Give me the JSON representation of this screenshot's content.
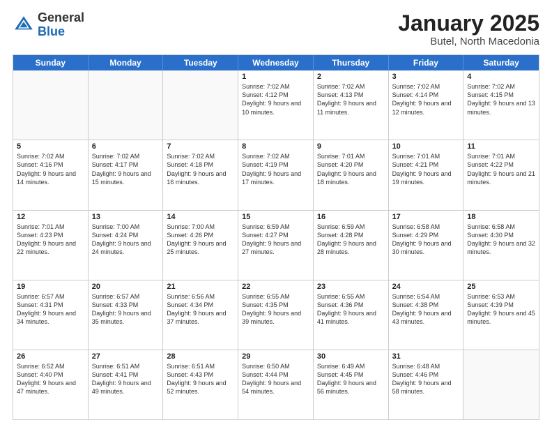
{
  "logo": {
    "general": "General",
    "blue": "Blue"
  },
  "title": "January 2025",
  "location": "Butel, North Macedonia",
  "days": [
    "Sunday",
    "Monday",
    "Tuesday",
    "Wednesday",
    "Thursday",
    "Friday",
    "Saturday"
  ],
  "rows": [
    [
      {
        "day": "",
        "sunrise": "",
        "sunset": "",
        "daylight": "",
        "empty": true
      },
      {
        "day": "",
        "sunrise": "",
        "sunset": "",
        "daylight": "",
        "empty": true
      },
      {
        "day": "",
        "sunrise": "",
        "sunset": "",
        "daylight": "",
        "empty": true
      },
      {
        "day": "1",
        "sunrise": "Sunrise: 7:02 AM",
        "sunset": "Sunset: 4:12 PM",
        "daylight": "Daylight: 9 hours and 10 minutes."
      },
      {
        "day": "2",
        "sunrise": "Sunrise: 7:02 AM",
        "sunset": "Sunset: 4:13 PM",
        "daylight": "Daylight: 9 hours and 11 minutes."
      },
      {
        "day": "3",
        "sunrise": "Sunrise: 7:02 AM",
        "sunset": "Sunset: 4:14 PM",
        "daylight": "Daylight: 9 hours and 12 minutes."
      },
      {
        "day": "4",
        "sunrise": "Sunrise: 7:02 AM",
        "sunset": "Sunset: 4:15 PM",
        "daylight": "Daylight: 9 hours and 13 minutes."
      }
    ],
    [
      {
        "day": "5",
        "sunrise": "Sunrise: 7:02 AM",
        "sunset": "Sunset: 4:16 PM",
        "daylight": "Daylight: 9 hours and 14 minutes."
      },
      {
        "day": "6",
        "sunrise": "Sunrise: 7:02 AM",
        "sunset": "Sunset: 4:17 PM",
        "daylight": "Daylight: 9 hours and 15 minutes."
      },
      {
        "day": "7",
        "sunrise": "Sunrise: 7:02 AM",
        "sunset": "Sunset: 4:18 PM",
        "daylight": "Daylight: 9 hours and 16 minutes."
      },
      {
        "day": "8",
        "sunrise": "Sunrise: 7:02 AM",
        "sunset": "Sunset: 4:19 PM",
        "daylight": "Daylight: 9 hours and 17 minutes."
      },
      {
        "day": "9",
        "sunrise": "Sunrise: 7:01 AM",
        "sunset": "Sunset: 4:20 PM",
        "daylight": "Daylight: 9 hours and 18 minutes."
      },
      {
        "day": "10",
        "sunrise": "Sunrise: 7:01 AM",
        "sunset": "Sunset: 4:21 PM",
        "daylight": "Daylight: 9 hours and 19 minutes."
      },
      {
        "day": "11",
        "sunrise": "Sunrise: 7:01 AM",
        "sunset": "Sunset: 4:22 PM",
        "daylight": "Daylight: 9 hours and 21 minutes."
      }
    ],
    [
      {
        "day": "12",
        "sunrise": "Sunrise: 7:01 AM",
        "sunset": "Sunset: 4:23 PM",
        "daylight": "Daylight: 9 hours and 22 minutes."
      },
      {
        "day": "13",
        "sunrise": "Sunrise: 7:00 AM",
        "sunset": "Sunset: 4:24 PM",
        "daylight": "Daylight: 9 hours and 24 minutes."
      },
      {
        "day": "14",
        "sunrise": "Sunrise: 7:00 AM",
        "sunset": "Sunset: 4:26 PM",
        "daylight": "Daylight: 9 hours and 25 minutes."
      },
      {
        "day": "15",
        "sunrise": "Sunrise: 6:59 AM",
        "sunset": "Sunset: 4:27 PM",
        "daylight": "Daylight: 9 hours and 27 minutes."
      },
      {
        "day": "16",
        "sunrise": "Sunrise: 6:59 AM",
        "sunset": "Sunset: 4:28 PM",
        "daylight": "Daylight: 9 hours and 28 minutes."
      },
      {
        "day": "17",
        "sunrise": "Sunrise: 6:58 AM",
        "sunset": "Sunset: 4:29 PM",
        "daylight": "Daylight: 9 hours and 30 minutes."
      },
      {
        "day": "18",
        "sunrise": "Sunrise: 6:58 AM",
        "sunset": "Sunset: 4:30 PM",
        "daylight": "Daylight: 9 hours and 32 minutes."
      }
    ],
    [
      {
        "day": "19",
        "sunrise": "Sunrise: 6:57 AM",
        "sunset": "Sunset: 4:31 PM",
        "daylight": "Daylight: 9 hours and 34 minutes."
      },
      {
        "day": "20",
        "sunrise": "Sunrise: 6:57 AM",
        "sunset": "Sunset: 4:33 PM",
        "daylight": "Daylight: 9 hours and 35 minutes."
      },
      {
        "day": "21",
        "sunrise": "Sunrise: 6:56 AM",
        "sunset": "Sunset: 4:34 PM",
        "daylight": "Daylight: 9 hours and 37 minutes."
      },
      {
        "day": "22",
        "sunrise": "Sunrise: 6:55 AM",
        "sunset": "Sunset: 4:35 PM",
        "daylight": "Daylight: 9 hours and 39 minutes."
      },
      {
        "day": "23",
        "sunrise": "Sunrise: 6:55 AM",
        "sunset": "Sunset: 4:36 PM",
        "daylight": "Daylight: 9 hours and 41 minutes."
      },
      {
        "day": "24",
        "sunrise": "Sunrise: 6:54 AM",
        "sunset": "Sunset: 4:38 PM",
        "daylight": "Daylight: 9 hours and 43 minutes."
      },
      {
        "day": "25",
        "sunrise": "Sunrise: 6:53 AM",
        "sunset": "Sunset: 4:39 PM",
        "daylight": "Daylight: 9 hours and 45 minutes."
      }
    ],
    [
      {
        "day": "26",
        "sunrise": "Sunrise: 6:52 AM",
        "sunset": "Sunset: 4:40 PM",
        "daylight": "Daylight: 9 hours and 47 minutes."
      },
      {
        "day": "27",
        "sunrise": "Sunrise: 6:51 AM",
        "sunset": "Sunset: 4:41 PM",
        "daylight": "Daylight: 9 hours and 49 minutes."
      },
      {
        "day": "28",
        "sunrise": "Sunrise: 6:51 AM",
        "sunset": "Sunset: 4:43 PM",
        "daylight": "Daylight: 9 hours and 52 minutes."
      },
      {
        "day": "29",
        "sunrise": "Sunrise: 6:50 AM",
        "sunset": "Sunset: 4:44 PM",
        "daylight": "Daylight: 9 hours and 54 minutes."
      },
      {
        "day": "30",
        "sunrise": "Sunrise: 6:49 AM",
        "sunset": "Sunset: 4:45 PM",
        "daylight": "Daylight: 9 hours and 56 minutes."
      },
      {
        "day": "31",
        "sunrise": "Sunrise: 6:48 AM",
        "sunset": "Sunset: 4:46 PM",
        "daylight": "Daylight: 9 hours and 58 minutes."
      },
      {
        "day": "",
        "sunrise": "",
        "sunset": "",
        "daylight": "",
        "empty": true
      }
    ]
  ]
}
